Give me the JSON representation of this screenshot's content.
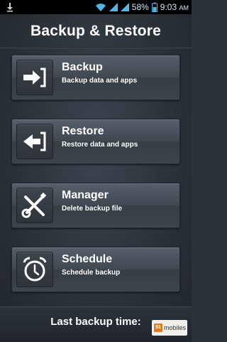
{
  "status_bar": {
    "battery": "58%",
    "time": "9:03",
    "ampm": "AM",
    "icons": [
      "download-icon",
      "wifi-icon",
      "signal-icon",
      "signal-icon",
      "battery-icon"
    ]
  },
  "header": {
    "title": "Backup & Restore"
  },
  "items": [
    {
      "title": "Backup",
      "subtitle": "Backup data and apps",
      "icon": "arrow-into-bracket-icon"
    },
    {
      "title": "Restore",
      "subtitle": "Restore data and apps",
      "icon": "arrow-out-of-bracket-icon"
    },
    {
      "title": "Manager",
      "subtitle": "Delete backup file",
      "icon": "wrench-screwdriver-icon"
    },
    {
      "title": "Schedule",
      "subtitle": "Schedule backup",
      "icon": "alarm-clock-icon"
    }
  ],
  "footer": {
    "label": "Last backup time:"
  },
  "watermark": {
    "mark": "91",
    "text": "mobiles"
  },
  "colors": {
    "status_icon": "#4fb6ea",
    "text": "#ffffff",
    "background": "#2a323b"
  }
}
